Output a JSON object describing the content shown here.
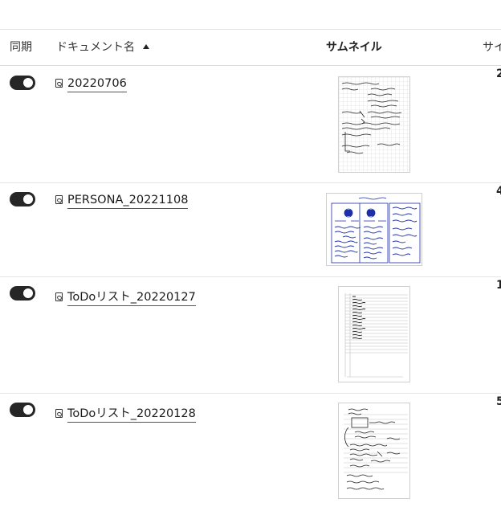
{
  "header": {
    "sync": "同期",
    "name": "ドキュメント名",
    "thumbnail": "サムネイル",
    "size": "サイ"
  },
  "rows": [
    {
      "name": "20220706",
      "sync_on": true,
      "size_fragment": "2"
    },
    {
      "name": "PERSONA_20221108",
      "sync_on": true,
      "size_fragment": "4"
    },
    {
      "name": "ToDoリスト_20220127",
      "sync_on": true,
      "size_fragment": "1"
    },
    {
      "name": "ToDoリスト_20220128",
      "sync_on": true,
      "size_fragment": "5"
    }
  ],
  "colors": {
    "toggle_on": "#262626",
    "ink_blue": "#1c2ea8",
    "ink_black": "#222222",
    "grid": "#c8c8c8"
  }
}
